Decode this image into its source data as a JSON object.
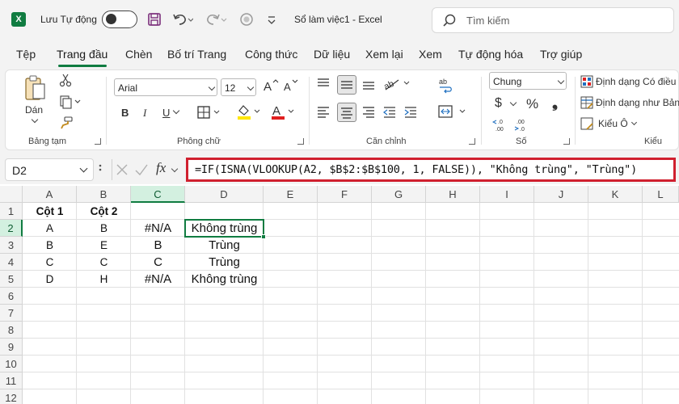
{
  "titlebar": {
    "logo_letter": "X",
    "autosave_label": "Lưu Tự động",
    "doc_title": "Sổ làm việc1  -  Excel",
    "search_placeholder": "Tìm kiếm"
  },
  "menu": {
    "items": [
      "Tệp",
      "Trang đầu",
      "Chèn",
      "Bố trí Trang",
      "Công thức",
      "Dữ liệu",
      "Xem lại",
      "Xem",
      "Tự động hóa",
      "Trợ giúp"
    ],
    "active": "Trang đầu"
  },
  "ribbon": {
    "clipboard": {
      "paste_label": "Dán",
      "group_label": "Bảng tạm"
    },
    "font": {
      "font_name": "Arial",
      "font_size": "12",
      "bold": "B",
      "italic": "I",
      "underline": "U",
      "font_color_letter": "A",
      "group_label": "Phông chữ"
    },
    "alignment": {
      "group_label": "Căn chỉnh"
    },
    "number": {
      "format": "Chung",
      "currency": "$",
      "percent": "%",
      "comma": "❟",
      "group_label": "Số"
    },
    "styles": {
      "conditional": "Định dạng Có điều",
      "as_table": "Định dạng như Bản",
      "cell_styles": "Kiểu Ô",
      "group_label": "Kiểu"
    }
  },
  "formula_bar": {
    "name_box": "D2",
    "fx": "fx",
    "formula": "=IF(ISNA(VLOOKUP(A2, $B$2:$B$100, 1, FALSE)), \"Không trùng\", \"Trùng\")"
  },
  "grid": {
    "columns": [
      "A",
      "B",
      "C",
      "D",
      "E",
      "F",
      "G",
      "H",
      "I",
      "J",
      "K",
      "L"
    ],
    "rows": [
      "1",
      "2",
      "3",
      "4",
      "5",
      "6",
      "7",
      "8",
      "9",
      "10",
      "11",
      "12"
    ],
    "selected_column": "C",
    "selected_row": "2",
    "active_cell": "D2",
    "header_row": {
      "A": "Cột 1",
      "B": "Cột 2"
    },
    "data": [
      {
        "A": "A",
        "B": "B",
        "C": "#N/A",
        "D": "Không trùng"
      },
      {
        "A": "B",
        "B": "E",
        "C": "B",
        "D": "Trùng"
      },
      {
        "A": "C",
        "B": "C",
        "C": "C",
        "D": "Trùng"
      },
      {
        "A": "D",
        "B": "H",
        "C": "#N/A",
        "D": "Không trùng"
      }
    ]
  },
  "colors": {
    "excel_green": "#107c41",
    "formula_highlight": "#d0202f",
    "fill_yellow": "#ffe600",
    "font_red": "#e01f1f"
  }
}
